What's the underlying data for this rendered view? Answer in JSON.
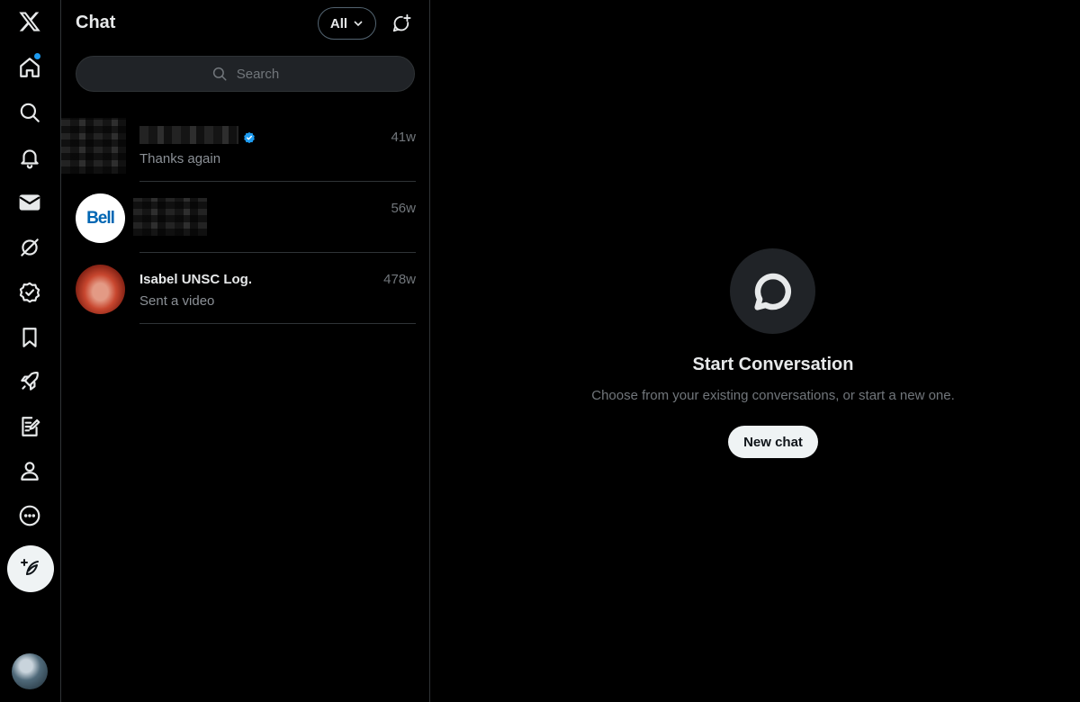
{
  "rail": {
    "items": [
      {
        "name": "x-logo-icon"
      },
      {
        "name": "home-icon"
      },
      {
        "name": "search-icon"
      },
      {
        "name": "notifications-icon"
      },
      {
        "name": "messages-icon"
      },
      {
        "name": "grok-icon"
      },
      {
        "name": "verified-icon"
      },
      {
        "name": "bookmark-icon"
      },
      {
        "name": "rocket-icon"
      },
      {
        "name": "articles-icon"
      },
      {
        "name": "profile-icon"
      },
      {
        "name": "more-icon"
      }
    ]
  },
  "chat_list": {
    "title": "Chat",
    "filter_label": "All",
    "search_placeholder": "Search",
    "conversations": [
      {
        "name": "",
        "preview": "Thanks again",
        "time": "41w",
        "verified": true
      },
      {
        "name": "",
        "preview": "",
        "time": "56w",
        "avatar_text": "Bell"
      },
      {
        "name": "Isabel UNSC Log.",
        "preview": "Sent a video",
        "time": "478w"
      }
    ]
  },
  "empty_state": {
    "title": "Start Conversation",
    "subtitle": "Choose from your existing conversations, or start a new one.",
    "button_label": "New chat"
  },
  "colors": {
    "background": "#000000",
    "accent": "#1d9bf0",
    "border": "#2f3336",
    "muted_text": "#71767b"
  }
}
